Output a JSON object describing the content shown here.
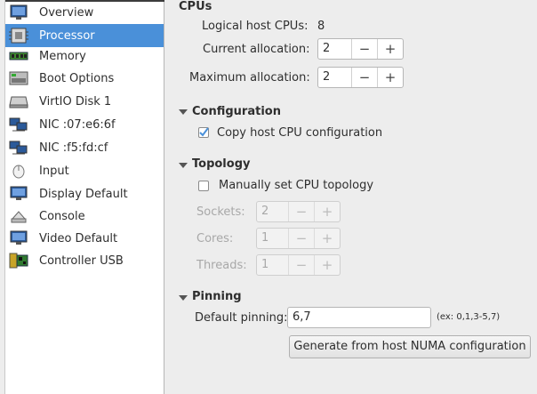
{
  "sidebar": {
    "items": [
      {
        "label": "Overview",
        "icon": "overview-icon"
      },
      {
        "label": "Processor",
        "icon": "processor-icon"
      },
      {
        "label": "Memory",
        "icon": "memory-icon"
      },
      {
        "label": "Boot Options",
        "icon": "boot-options-icon"
      },
      {
        "label": "VirtIO Disk 1",
        "icon": "disk-icon"
      },
      {
        "label": "NIC :07:e6:6f",
        "icon": "network-icon"
      },
      {
        "label": "NIC :f5:fd:cf",
        "icon": "network-icon"
      },
      {
        "label": "Input",
        "icon": "mouse-icon"
      },
      {
        "label": "Display Default",
        "icon": "display-icon"
      },
      {
        "label": "Console",
        "icon": "console-icon"
      },
      {
        "label": "Video Default",
        "icon": "video-icon"
      },
      {
        "label": "Controller USB",
        "icon": "usb-controller-icon"
      }
    ],
    "selected_index": 1
  },
  "cpus": {
    "title": "CPUs",
    "logical_label": "Logical host CPUs:",
    "logical_value": "8",
    "current_label": "Current allocation:",
    "current_value": "2",
    "maximum_label": "Maximum allocation:",
    "maximum_value": "2"
  },
  "configuration": {
    "title": "Configuration",
    "copy_host_label": "Copy host CPU configuration",
    "copy_host_checked": true
  },
  "topology": {
    "title": "Topology",
    "manual_label": "Manually set CPU topology",
    "manual_checked": false,
    "sockets_label": "Sockets:",
    "sockets_value": "2",
    "cores_label": "Cores:",
    "cores_value": "1",
    "threads_label": "Threads:",
    "threads_value": "1"
  },
  "pinning": {
    "title": "Pinning",
    "default_label": "Default pinning:",
    "default_value": "6,7",
    "hint": "(ex: 0,1,3-5,7)",
    "generate_label": "Generate from host NUMA configuration"
  },
  "spin_glyphs": {
    "minus": "−",
    "plus": "+"
  },
  "colors": {
    "selection": "#4a90d9",
    "check": "#4a90d9"
  }
}
